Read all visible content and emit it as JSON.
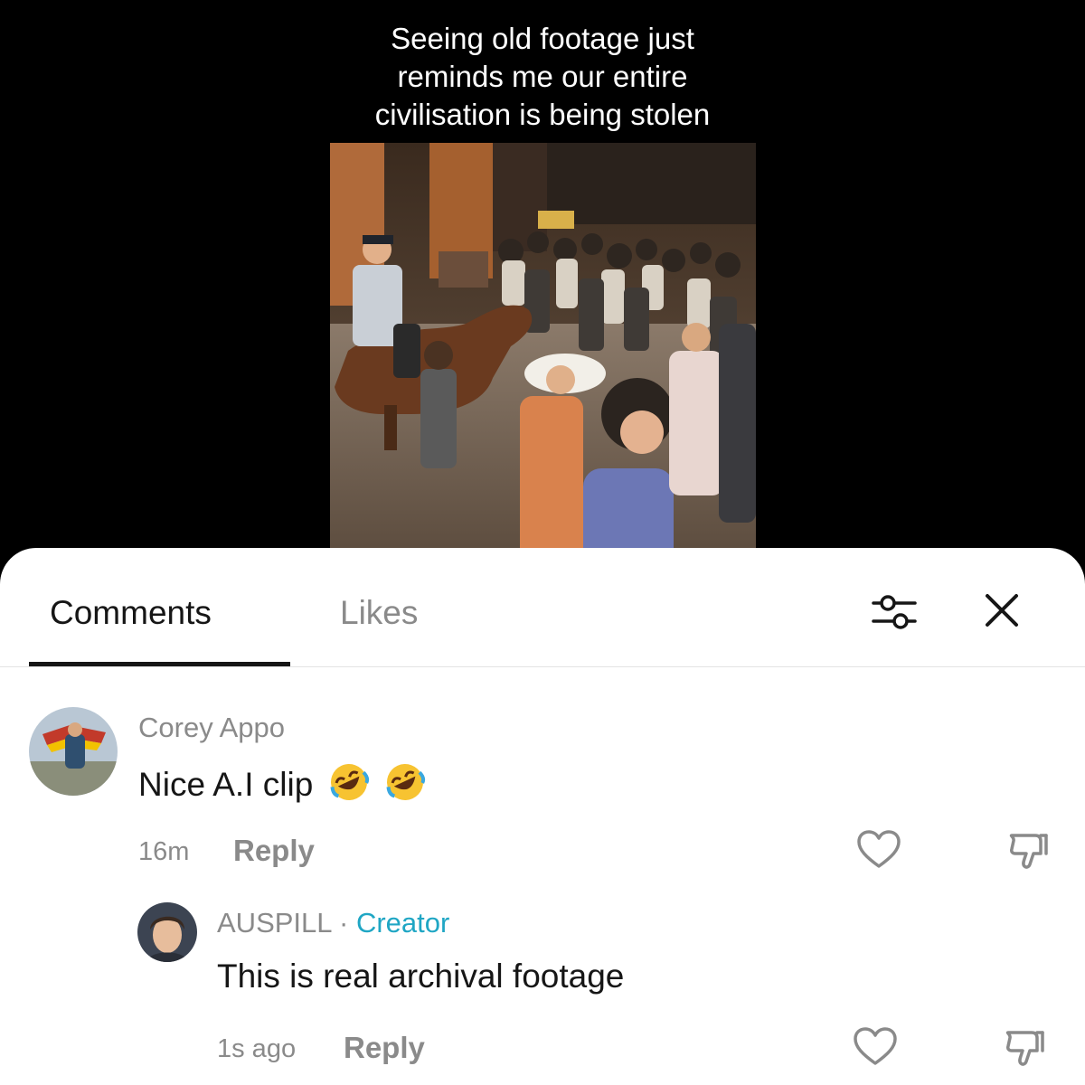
{
  "video": {
    "caption": "Seeing old footage just\nreminds me our entire\ncivilisation is being stolen"
  },
  "sheet": {
    "tabs": [
      {
        "label": "Comments",
        "active": true
      },
      {
        "label": "Likes",
        "active": false
      }
    ],
    "icons": {
      "filter": "sliders-icon",
      "close": "close-icon"
    }
  },
  "comments": [
    {
      "username": "Corey Appo",
      "text": "Nice A.I clip",
      "emoji": [
        "rolling-on-floor-laughing",
        "rolling-on-floor-laughing"
      ],
      "time": "16m",
      "reply_label": "Reply"
    }
  ],
  "replies": [
    {
      "username": "AUSPILL",
      "separator": "·",
      "badge": "Creator",
      "text": "This is real archival footage",
      "time": "1s ago",
      "reply_label": "Reply"
    }
  ],
  "colors": {
    "accent_creator": "#1fa6c4",
    "text_primary": "#161616",
    "text_secondary": "#8a8a8a"
  }
}
